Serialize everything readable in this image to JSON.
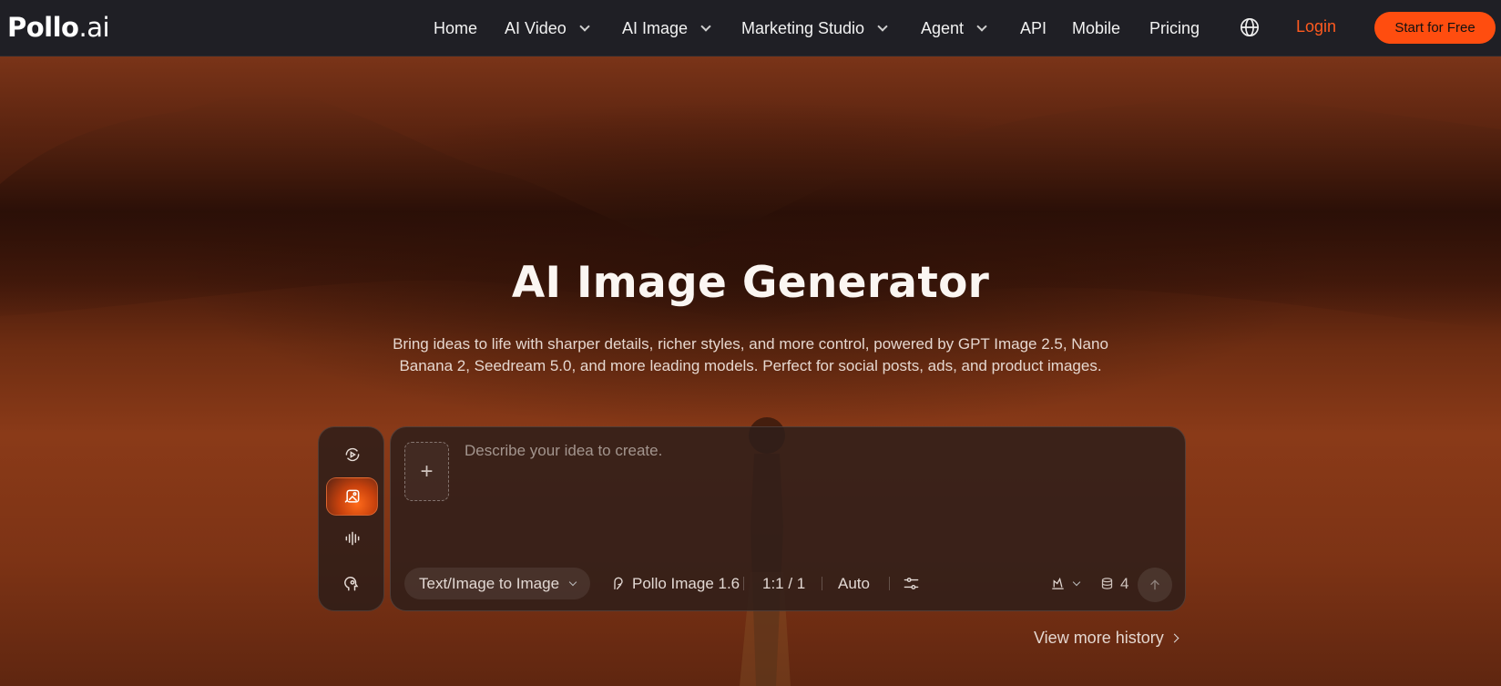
{
  "brand": {
    "logo_main": "Pollo",
    "logo_suffix": ".ai"
  },
  "nav": {
    "items": [
      {
        "label": "Home",
        "has_dropdown": false
      },
      {
        "label": "AI Video",
        "has_dropdown": true
      },
      {
        "label": "AI Image",
        "has_dropdown": true
      },
      {
        "label": "Marketing Studio",
        "has_dropdown": true
      },
      {
        "label": "Agent",
        "has_dropdown": true
      },
      {
        "label": "API",
        "has_dropdown": false
      },
      {
        "label": "Mobile",
        "has_dropdown": false
      },
      {
        "label": "Pricing",
        "has_dropdown": false
      }
    ],
    "language_icon": "globe-icon",
    "login_label": "Login",
    "cta_label": "Start for Free"
  },
  "hero": {
    "title": "AI Image Generator",
    "subtitle_line1": "Bring ideas to life with sharper details, richer styles, and more control, powered by GPT Image 2.5, Nano",
    "subtitle_line2": "Banana 2, Seedream 5.0, and more leading models. Perfect for social posts, ads, and product images."
  },
  "rail": {
    "items": [
      {
        "icon": "video-icon",
        "active": false
      },
      {
        "icon": "image-icon",
        "active": true
      },
      {
        "icon": "audio-wave-icon",
        "active": false
      },
      {
        "icon": "avatar-head-icon",
        "active": false
      }
    ]
  },
  "prompt": {
    "placeholder": "Describe your idea to create.",
    "value": "",
    "mode_label": "Text/Image to Image",
    "model_label": "Pollo Image 1.6",
    "ratio_label": "1:1 / 1",
    "quality_label": "Auto",
    "credits": "4"
  },
  "history_label": "View more history",
  "colors": {
    "accent": "#ff4d0f",
    "login": "#ff5a1f",
    "nav_bg": "#1f1f25"
  }
}
